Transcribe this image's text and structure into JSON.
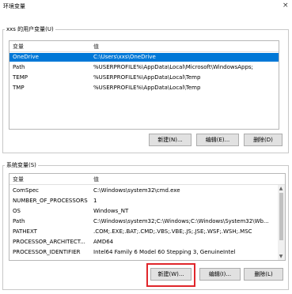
{
  "window": {
    "title": "环境变量",
    "close_glyph": "×"
  },
  "user_vars": {
    "group_label": "xxs 的用户变量(U)",
    "col_var": "变量",
    "col_val": "值",
    "rows": [
      {
        "name": "OneDrive",
        "value": "C:\\Users\\xxs\\OneDrive"
      },
      {
        "name": "Path",
        "value": "%USERPROFILE%\\AppData\\Local\\Microsoft\\WindowsApps;"
      },
      {
        "name": "TEMP",
        "value": "%USERPROFILE%\\AppData\\Local\\Temp"
      },
      {
        "name": "TMP",
        "value": "%USERPROFILE%\\AppData\\Local\\Temp"
      }
    ],
    "buttons": {
      "new": "新建(N)...",
      "edit": "编辑(E)...",
      "delete": "删除(D)"
    }
  },
  "sys_vars": {
    "group_label": "系统变量(S)",
    "col_var": "变量",
    "col_val": "值",
    "rows": [
      {
        "name": "ComSpec",
        "value": "C:\\Windows\\system32\\cmd.exe"
      },
      {
        "name": "NUMBER_OF_PROCESSORS",
        "value": "1"
      },
      {
        "name": "OS",
        "value": "Windows_NT"
      },
      {
        "name": "Path",
        "value": "C:\\Windows\\system32;C:\\Windows;C:\\Windows\\System32\\Wb..."
      },
      {
        "name": "PATHEXT",
        "value": ".COM;.EXE;.BAT;.CMD;.VBS;.VBE;.JS;.JSE;.WSF;.WSH;.MSC"
      },
      {
        "name": "PROCESSOR_ARCHITECT...",
        "value": "AMD64"
      },
      {
        "name": "PROCESSOR_IDENTIFIER",
        "value": "Intel64 Family 6 Model 60 Stepping 3, GenuineIntel"
      }
    ],
    "buttons": {
      "new": "新建(W)...",
      "edit": "编辑(I)...",
      "delete": "删除(L)"
    }
  },
  "colors": {
    "selection": "#0078d7",
    "highlight": "#e0262b"
  }
}
